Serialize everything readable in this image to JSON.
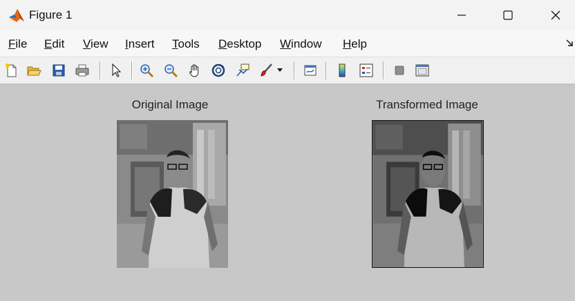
{
  "window": {
    "title": "Figure 1"
  },
  "menu": {
    "items": [
      {
        "label": "File",
        "mnemonic": "F",
        "rest": "ile"
      },
      {
        "label": "Edit",
        "mnemonic": "E",
        "rest": "dit"
      },
      {
        "label": "View",
        "mnemonic": "V",
        "rest": "iew"
      },
      {
        "label": "Insert",
        "mnemonic": "I",
        "rest": "nsert"
      },
      {
        "label": "Tools",
        "mnemonic": "T",
        "rest": "ools"
      },
      {
        "label": "Desktop",
        "mnemonic": "D",
        "rest": "esktop"
      },
      {
        "label": "Window",
        "mnemonic": "W",
        "rest": "indow"
      },
      {
        "label": "Help",
        "mnemonic": "H",
        "rest": "elp"
      }
    ]
  },
  "toolbar": {
    "icons": [
      "new-figure-icon",
      "open-file-icon",
      "save-icon",
      "print-icon",
      "select-pointer-icon",
      "zoom-in-icon",
      "zoom-out-icon",
      "pan-hand-icon",
      "rotate-3d-icon",
      "data-cursor-icon",
      "brush-icon",
      "link-plot-icon",
      "colorbar-icon",
      "legend-icon",
      "hide-plot-tools-icon",
      "show-plot-tools-icon"
    ]
  },
  "axes": {
    "left_title": "Original Image",
    "right_title": "Transformed Image"
  },
  "colors": {
    "figure_bg": "#c8c8c8",
    "titlebar_bg": "#f3f3f3",
    "toolbar_bg": "#f0f0f0"
  }
}
